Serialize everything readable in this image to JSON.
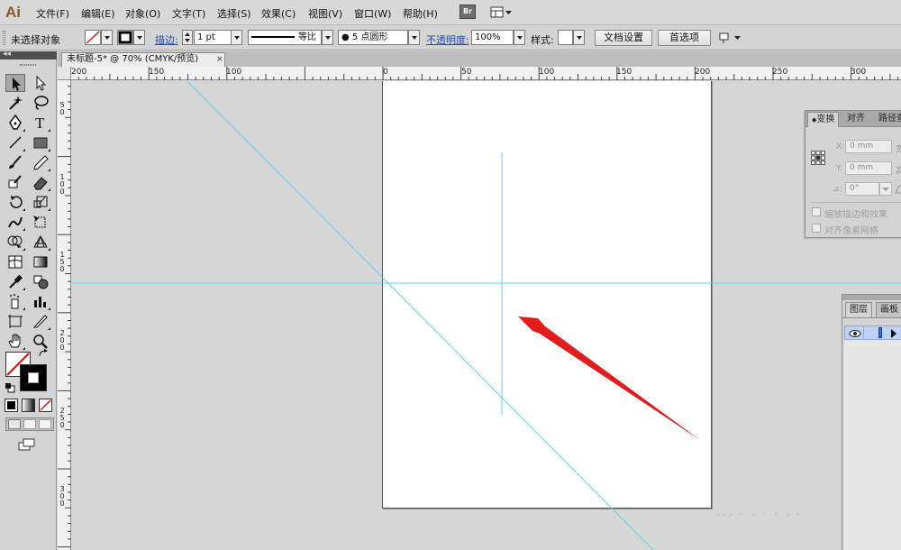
{
  "app": {
    "logo": "Ai"
  },
  "menu": {
    "items": [
      "文件(F)",
      "编辑(E)",
      "对象(O)",
      "文字(T)",
      "选择(S)",
      "效果(C)",
      "视图(V)",
      "窗口(W)",
      "帮助(H)"
    ],
    "bridge_label": "Br"
  },
  "control_bar": {
    "selection_status": "未选择对象",
    "stroke_label": "描边:",
    "stroke_weight": "1 pt",
    "profile_label": "等比",
    "brush_label": "● 5 点圆形",
    "opacity_label": "不透明度:",
    "opacity_value": "100%",
    "style_label": "样式:",
    "doc_setup_button": "文档设置",
    "preferences_button": "首选项"
  },
  "document": {
    "tab_title": "未标题-5* @ 70% (CMYK/预览)",
    "close_glyph": "×"
  },
  "rulers": {
    "horizontal": [
      "200",
      "150",
      "100",
      "0",
      "50",
      "100",
      "150",
      "200",
      "250",
      "300"
    ],
    "vertical": [
      "50",
      "100",
      "150",
      "200",
      "250",
      "300"
    ]
  },
  "transform_panel": {
    "tabs": [
      "变换",
      "对齐",
      "路径查"
    ],
    "x_label": "X:",
    "y_label": "Y:",
    "x_value": "0 mm",
    "y_value": "0 mm",
    "w_label": "宽",
    "h_label": "高",
    "angle_label": "⊿:",
    "angle_value": "0°",
    "scale_strokes": "缩放描边和效果",
    "align_pixel": "对齐像素网格"
  },
  "layers_panel": {
    "tabs": [
      "图层",
      "画板"
    ]
  },
  "colors": {
    "guide": "#5fd5e4",
    "arrow": "#e11d1d",
    "selection_blue": "#1c4cb6"
  }
}
